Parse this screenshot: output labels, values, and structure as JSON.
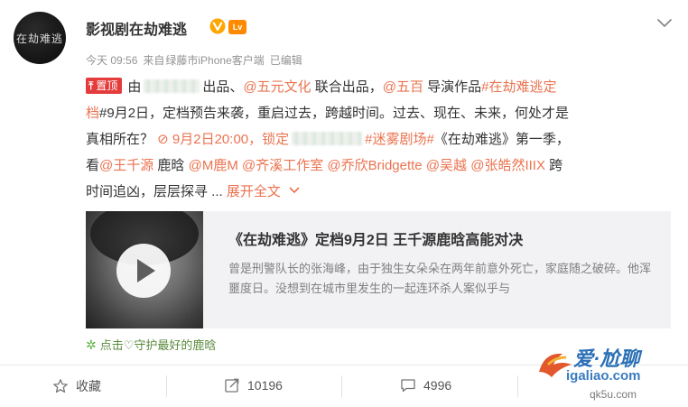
{
  "header": {
    "avatar_text": "在劫难逃",
    "name": "影视剧在劫难逃",
    "badge_level": "Lv",
    "time": "今天 09:56",
    "source_prefix": "来自",
    "source": "绿藤市iPhone客户端",
    "edited": "已编辑"
  },
  "post": {
    "pin_label": "置顶",
    "lines": [
      [
        {
          "t": "text",
          "v": "由"
        },
        {
          "t": "blur"
        },
        {
          "t": "text",
          "v": "出品、"
        },
        {
          "t": "link",
          "v": "@五元文化"
        },
        {
          "t": "text",
          "v": " 联合出品，"
        },
        {
          "t": "link",
          "v": "@五百"
        },
        {
          "t": "text",
          "v": " 导演作品"
        },
        {
          "t": "link",
          "v": "#在劫难逃定"
        }
      ],
      [
        {
          "t": "link",
          "v": "档"
        },
        {
          "t": "text",
          "v": "#9月2日，定档预告来袭，重启过去，跨越时间。过去、现在、未来，何处才是"
        }
      ],
      [
        {
          "t": "text",
          "v": "真相所在？ "
        },
        {
          "t": "link",
          "v": "⊘ 9月2日20:00，锁定"
        },
        {
          "t": "blur2"
        },
        {
          "t": "link",
          "v": "#迷雾剧场#"
        },
        {
          "t": "text",
          "v": "《在劫难逃》第一季，"
        }
      ],
      [
        {
          "t": "text",
          "v": "看"
        },
        {
          "t": "link",
          "v": "@王千源"
        },
        {
          "t": "text",
          "v": " 鹿晗 "
        },
        {
          "t": "link",
          "v": "@M鹿M"
        },
        {
          "t": "text",
          "v": " "
        },
        {
          "t": "link",
          "v": "@齐溪工作室"
        },
        {
          "t": "text",
          "v": " "
        },
        {
          "t": "link",
          "v": "@乔欣Bridgette"
        },
        {
          "t": "text",
          "v": " "
        },
        {
          "t": "link",
          "v": "@吴越"
        },
        {
          "t": "text",
          "v": " "
        },
        {
          "t": "link",
          "v": "@张皓然IIIX"
        },
        {
          "t": "text",
          "v": " 跨"
        }
      ],
      [
        {
          "t": "text",
          "v": "时间追凶，层层探寻 ... "
        },
        {
          "t": "link",
          "v": "展开全文"
        }
      ]
    ]
  },
  "card": {
    "title": "《在劫难逃》定档9月2日 王千源鹿晗高能对决",
    "desc": "曾是刑警队长的张海峰，由于独生女朵朵在两年前意外死亡，家庭随之破碎。他浑噩度日。没想到在城市里发生的一起连环杀人案似乎与"
  },
  "promo": "点击♡守护最好的鹿晗",
  "actions": {
    "favorite": "收藏",
    "repost": "10196",
    "comment": "4996"
  },
  "watermark": {
    "brand": "爱·尬聊",
    "url": "igaliao.com",
    "url2": "qk5u.com"
  },
  "colors": {
    "link": "#eb7350",
    "pin": "#e43c3c",
    "verified": "#ffa500"
  }
}
